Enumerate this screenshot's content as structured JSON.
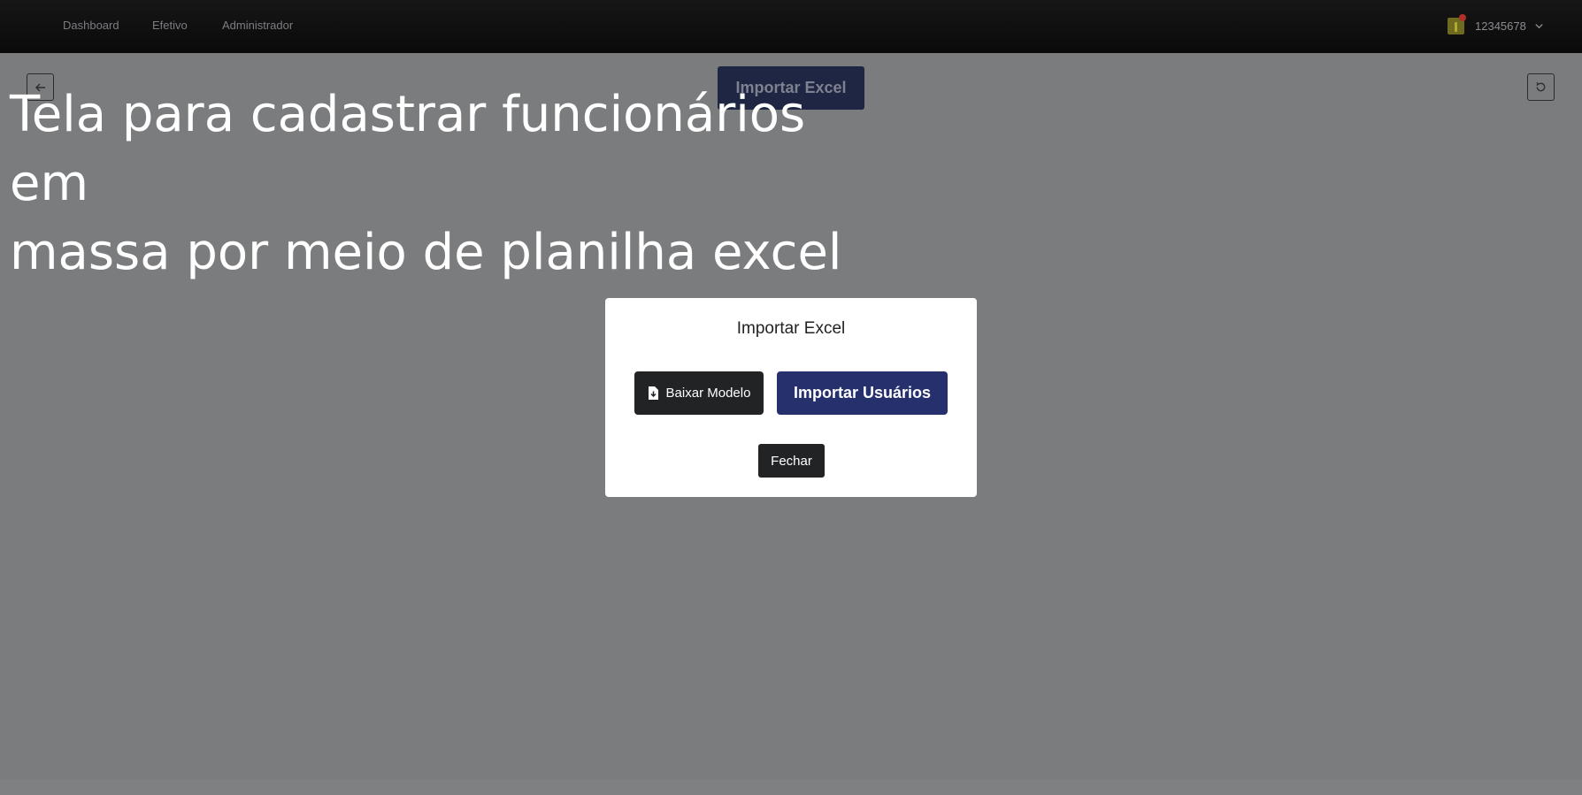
{
  "nav": {
    "links": [
      {
        "label": "Dashboard"
      },
      {
        "label": "Efetivo"
      },
      {
        "label": "Administrador"
      }
    ],
    "user": {
      "id": "12345678",
      "avatar_icon": "avatar-icon",
      "notification_color": "#b2302a"
    }
  },
  "toolbar": {
    "back_icon": "arrow-left-icon",
    "refresh_icon": "refresh-icon",
    "import_button_label": "Importar Excel"
  },
  "caption": "Tela para cadastrar funcionários em\nmassa por meio de planilha excel",
  "modal": {
    "title": "Importar Excel",
    "download_button_label": "Baixar Modelo",
    "download_icon": "file-download-icon",
    "import_users_button_label": "Importar Usuários",
    "close_button_label": "Fechar"
  },
  "colors": {
    "primary": "#26306d",
    "dark_button": "#222325",
    "overlay": "#7b7c7e"
  }
}
